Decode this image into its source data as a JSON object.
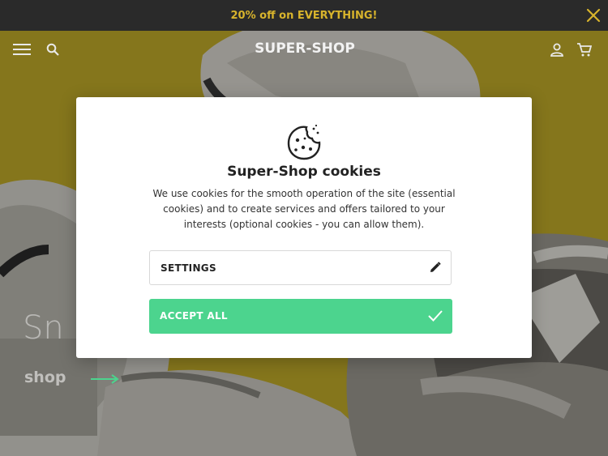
{
  "promo": {
    "text": "20% off on EVERYTHING!",
    "close_icon": "close-icon"
  },
  "header": {
    "menu_icon": "hamburger-menu-icon",
    "search_icon": "search-icon",
    "logo": "SUPER-SHOP",
    "account_icon": "user-icon",
    "cart_icon": "cart-icon"
  },
  "hero": {
    "title": "Sn",
    "shop_link": "shop"
  },
  "cookie_modal": {
    "icon": "cookie-icon",
    "title": "Super-Shop cookies",
    "text": "We use cookies for the smooth operation of the site (essential cookies) and to create services and offers tailored to your interests (optional cookies - you can allow them).",
    "settings_label": "SETTINGS",
    "settings_icon": "pencil-icon",
    "accept_label": "ACCEPT ALL",
    "accept_icon": "checkmark-icon"
  },
  "colors": {
    "promo_bg": "#2a2a2a",
    "promo_text": "#d8b42c",
    "accept_button": "#4cd48e",
    "hero_bg": "#b7a326"
  }
}
